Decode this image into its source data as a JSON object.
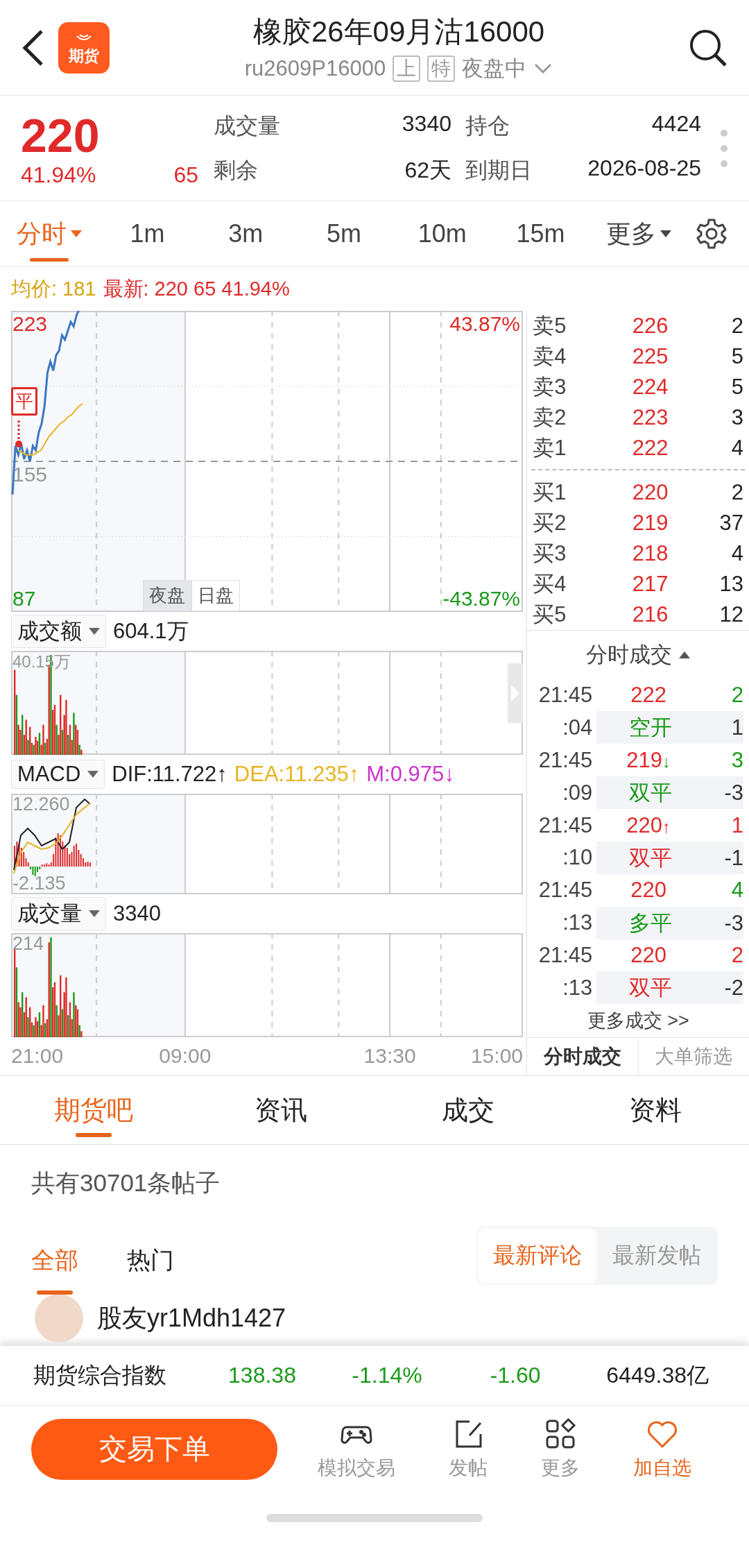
{
  "header": {
    "logo": "期货",
    "title": "橡胶26年09月沽16000",
    "code": "ru2609P16000",
    "badges": [
      "上",
      "特"
    ],
    "session": "夜盘中"
  },
  "quote": {
    "price": "220",
    "rising": true,
    "change_pct": "41.94%",
    "change": "65",
    "stats": [
      {
        "label": "成交量",
        "value": "3340"
      },
      {
        "label": "持仓",
        "value": "4424"
      },
      {
        "label": "剩余",
        "value": "62天"
      },
      {
        "label": "到期日",
        "value": "2026-08-25"
      }
    ]
  },
  "period_tabs": [
    {
      "label": "分时",
      "selected": true,
      "dropdown": true
    },
    {
      "label": "1m",
      "selected": false,
      "dropdown": false
    },
    {
      "label": "3m",
      "selected": false,
      "dropdown": false
    },
    {
      "label": "5m",
      "selected": false,
      "dropdown": false
    },
    {
      "label": "10m",
      "selected": false,
      "dropdown": false
    },
    {
      "label": "15m",
      "selected": false,
      "dropdown": false
    },
    {
      "label": "更多",
      "selected": false,
      "dropdown": true
    }
  ],
  "info_line": {
    "average": "均价: 181",
    "latest": "最新: 220 65 41.94%"
  },
  "main_chart": {
    "high": "223",
    "base": "155",
    "low": "87",
    "high_pct": "43.87%",
    "low_pct": "-43.87%",
    "marker": "平",
    "session_tabs": [
      {
        "label": "夜盘",
        "selected": true
      },
      {
        "label": "日盘",
        "selected": false
      }
    ]
  },
  "panels": [
    {
      "kind": "amount",
      "selector": "成交额",
      "value": "604.1万",
      "max": "40.15万"
    },
    {
      "kind": "macd",
      "selector": "MACD",
      "indicators": [
        {
          "text": "DIF:11.722↑",
          "color": "#222222"
        },
        {
          "text": "DEA:11.235↑",
          "color": "#e6b422"
        },
        {
          "text": "M:0.975↓",
          "color": "#cc33cc"
        }
      ],
      "max": "12.260",
      "min": "-2.135"
    },
    {
      "kind": "volume",
      "selector": "成交量",
      "value": "3340",
      "max": "214"
    }
  ],
  "time_axis": [
    "21:00",
    "09:00",
    "13:30",
    "15:00"
  ],
  "order_book": {
    "asks": [
      {
        "label": "卖5",
        "price": "226",
        "volume": "2"
      },
      {
        "label": "卖4",
        "price": "225",
        "volume": "5"
      },
      {
        "label": "卖3",
        "price": "224",
        "volume": "5"
      },
      {
        "label": "卖2",
        "price": "223",
        "volume": "3"
      },
      {
        "label": "卖1",
        "price": "222",
        "volume": "4"
      }
    ],
    "bids": [
      {
        "label": "买1",
        "price": "220",
        "volume": "2"
      },
      {
        "label": "买2",
        "price": "219",
        "volume": "37"
      },
      {
        "label": "买3",
        "price": "218",
        "volume": "4"
      },
      {
        "label": "买4",
        "price": "217",
        "volume": "13"
      },
      {
        "label": "买5",
        "price": "216",
        "volume": "12"
      }
    ]
  },
  "trades": {
    "title": "分时成交",
    "rows": [
      {
        "time": "21:45",
        "price": "222",
        "arrow": "",
        "volume": "2",
        "sub_time": ":04",
        "type": "空开",
        "qty": "1",
        "buy": false
      },
      {
        "time": "21:45",
        "price": "219",
        "arrow": "↓",
        "volume": "3",
        "sub_time": ":09",
        "type": "双平",
        "qty": "-3",
        "buy": false
      },
      {
        "time": "21:45",
        "price": "220",
        "arrow": "↑",
        "volume": "1",
        "sub_time": ":10",
        "type": "双平",
        "qty": "-1",
        "buy": true
      },
      {
        "time": "21:45",
        "price": "220",
        "arrow": "",
        "volume": "4",
        "sub_time": ":13",
        "type": "多平",
        "qty": "-3",
        "buy": false
      },
      {
        "time": "21:45",
        "price": "220",
        "arrow": "",
        "volume": "2",
        "sub_time": ":13",
        "type": "双平",
        "qty": "-2",
        "buy": true
      }
    ],
    "more": "更多成交 >>",
    "tabs": [
      {
        "label": "分时成交",
        "selected": true
      },
      {
        "label": "大单筛选",
        "selected": false
      }
    ]
  },
  "community_tabs": [
    {
      "label": "期货吧",
      "selected": true
    },
    {
      "label": "资讯",
      "selected": false
    },
    {
      "label": "成交",
      "selected": false
    },
    {
      "label": "资料",
      "selected": false
    }
  ],
  "post_count": "共有30701条帖子",
  "filter_tabs": [
    {
      "label": "全部",
      "selected": true
    },
    {
      "label": "热门",
      "selected": false
    }
  ],
  "sort_tabs": [
    {
      "label": "最新评论",
      "selected": true
    },
    {
      "label": "最新发帖",
      "selected": false
    }
  ],
  "post": {
    "user": "股友yr1Mdh1427"
  },
  "index_bar": {
    "name": "期货综合指数",
    "price": "138.38",
    "change_pct": "-1.14%",
    "change": "-1.60",
    "turnover": "6449.38亿",
    "rising": false
  },
  "bottom_bar": {
    "trade_button": "交易下单",
    "nav": [
      {
        "kind": "gamepad",
        "label": "模拟交易",
        "highlighted": false
      },
      {
        "kind": "edit",
        "label": "发帖",
        "highlighted": false
      },
      {
        "kind": "grid",
        "label": "更多",
        "highlighted": false
      },
      {
        "kind": "heart",
        "label": "加自选",
        "highlighted": true
      }
    ]
  }
}
